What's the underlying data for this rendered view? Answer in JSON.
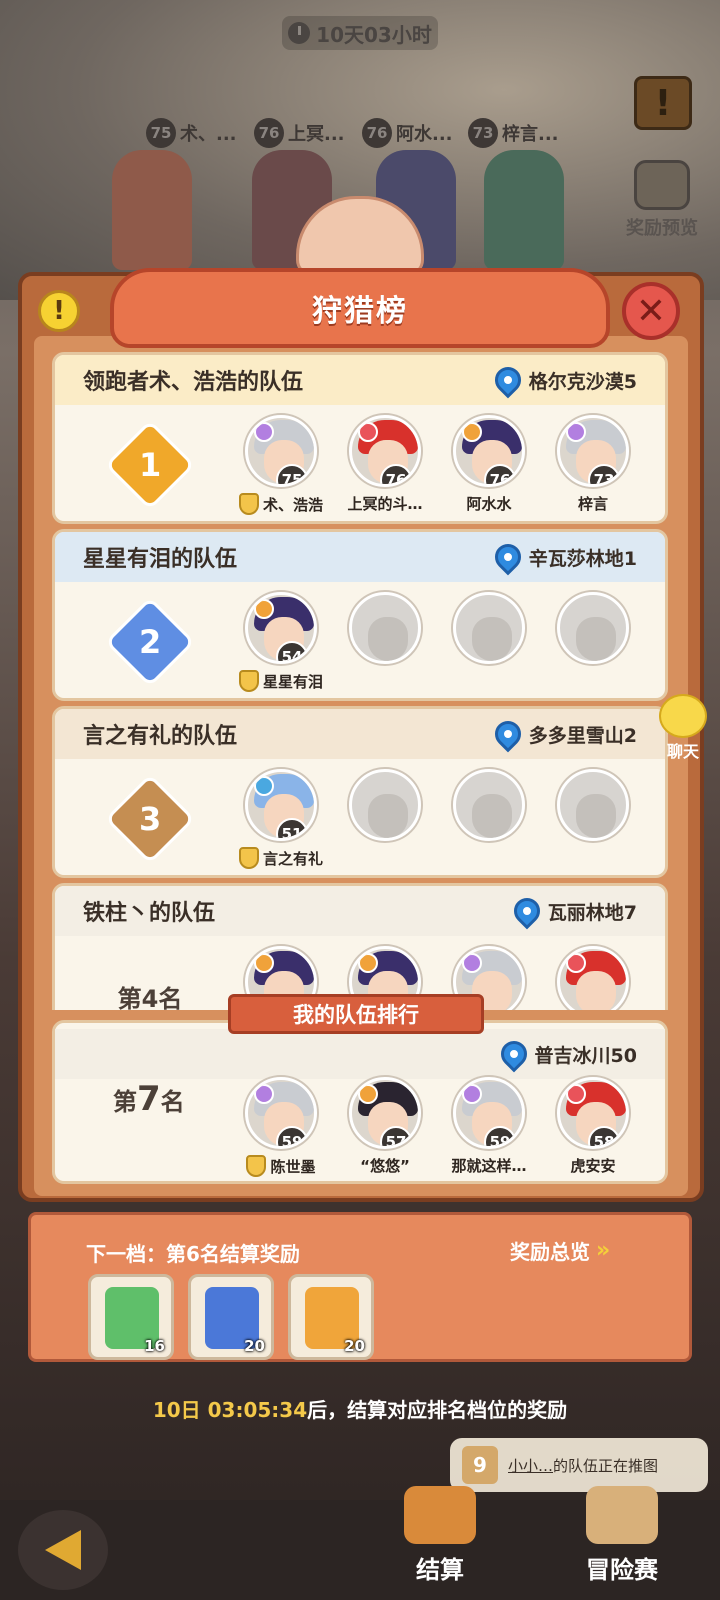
{
  "timer": "10天03小时",
  "bg_ranks": [
    {
      "level": "75",
      "name": "术、..."
    },
    {
      "level": "76",
      "name": "上冥..."
    },
    {
      "level": "76",
      "name": "阿水..."
    },
    {
      "level": "73",
      "name": "梓言..."
    }
  ],
  "side": {
    "reward_preview": "奖励预览",
    "chat": "聊天"
  },
  "panel": {
    "title": "狩猎榜"
  },
  "teams": [
    {
      "name": "领跑者术、浩浩的队伍",
      "location": "格尔克沙漠5",
      "rank": "1",
      "badge_color": "#f0a82a",
      "header_color": "#fbecc7",
      "members": [
        {
          "name": "术、浩浩",
          "level": "75",
          "leader": true,
          "elem_color": "#b27fe0",
          "hair": "#c9ccd1"
        },
        {
          "name": "上冥的斗…",
          "level": "76",
          "leader": false,
          "elem_color": "#e9535a",
          "hair": "#d8312c"
        },
        {
          "name": "阿水水",
          "level": "76",
          "leader": false,
          "elem_color": "#f0a23a",
          "hair": "#3a2f6b"
        },
        {
          "name": "梓言",
          "level": "73",
          "leader": false,
          "elem_color": "#b27fe0",
          "hair": "#c9ccd1"
        }
      ]
    },
    {
      "name": "星星有泪的队伍",
      "location": "辛瓦莎林地1",
      "rank": "2",
      "badge_color": "#5f8ee3",
      "header_color": "#dde9f3",
      "members": [
        {
          "name": "星星有泪",
          "level": "54",
          "leader": true,
          "elem_color": "#f0a23a",
          "hair": "#3a2f6b"
        }
      ]
    },
    {
      "name": "言之有礼的队伍",
      "location": "多多里雪山2",
      "rank": "3",
      "badge_color": "#c58e52",
      "header_color": "#f3e6d3",
      "members": [
        {
          "name": "言之有礼",
          "level": "51",
          "leader": true,
          "elem_color": "#4aa8e0",
          "hair": "#8ab4e8"
        }
      ]
    },
    {
      "name": "铁柱丶的队伍",
      "location": "瓦丽林地7",
      "rank": "第4名",
      "badge_color": "",
      "header_color": "#f3eee4",
      "members": [
        {
          "name": "",
          "level": "",
          "leader": false,
          "elem_color": "#f0a23a",
          "hair": "#3a2f6b"
        },
        {
          "name": "",
          "level": "",
          "leader": false,
          "elem_color": "#f0a23a",
          "hair": "#3a2f6b"
        },
        {
          "name": "",
          "level": "",
          "leader": false,
          "elem_color": "#b27fe0",
          "hair": "#c9ccd1"
        },
        {
          "name": "",
          "level": "",
          "leader": false,
          "elem_color": "#e9535a",
          "hair": "#d8312c"
        }
      ]
    }
  ],
  "my_team": {
    "title": "我的队伍排行",
    "location": "普吉冰川50",
    "rank_prefix": "第",
    "rank_number": "7",
    "rank_suffix": "名",
    "members": [
      {
        "name": "陈世墨",
        "level": "59",
        "leader": true,
        "elem_color": "#b27fe0",
        "hair": "#c9ccd1"
      },
      {
        "name": "“悠悠”",
        "level": "57",
        "leader": false,
        "elem_color": "#f0a23a",
        "hair": "#2a2430"
      },
      {
        "name": "那就这样…",
        "level": "59",
        "leader": false,
        "elem_color": "#b27fe0",
        "hair": "#c9ccd1"
      },
      {
        "name": "虎安安",
        "level": "58",
        "leader": false,
        "elem_color": "#e9535a",
        "hair": "#d8312c"
      }
    ]
  },
  "rewards": {
    "next_tier": "下一档：第6名结算奖励",
    "overview": "奖励总览",
    "items": [
      {
        "qty": "16",
        "color": "#5fbf6a",
        "icon": "green-scroll-icon"
      },
      {
        "qty": "20",
        "color": "#4b78d8",
        "icon": "blue-crystal-icon"
      },
      {
        "qty": "20",
        "color": "#f0a53a",
        "icon": "orange-scroll-icon"
      }
    ]
  },
  "countdown": {
    "time": "10日 03:05:34",
    "text": "后，结算对应排名档位的奖励"
  },
  "notice": {
    "number": "9",
    "name": "小小…",
    "text": "的队伍正在推图"
  },
  "nav": {
    "settle": "结算",
    "adventure": "冒险赛"
  }
}
